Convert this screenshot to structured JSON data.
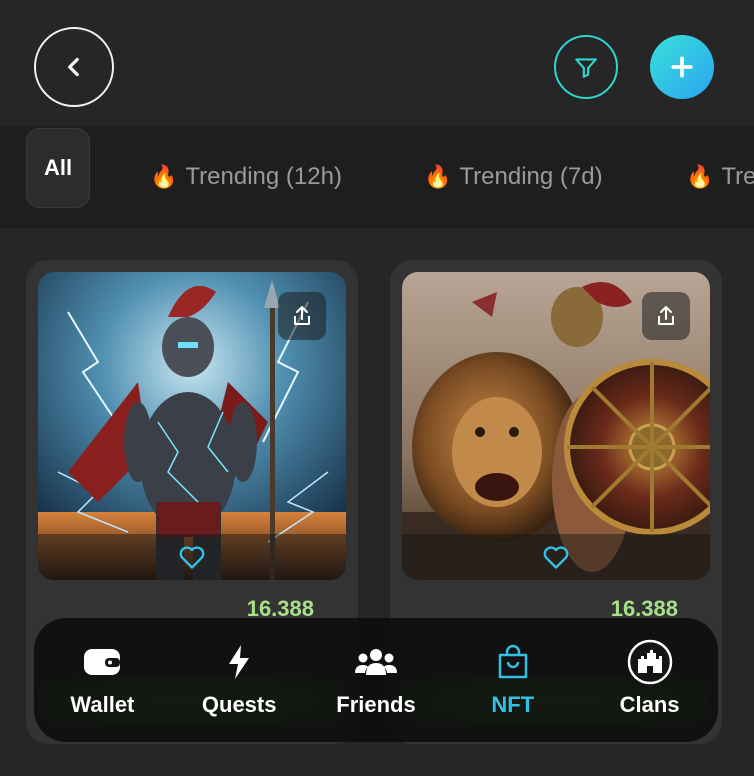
{
  "header": {
    "back_icon": "chevron-left-icon",
    "filter_icon": "filter-icon",
    "add_icon": "plus-icon",
    "accent": "#2fd6d0"
  },
  "tabs": [
    {
      "label": "All",
      "active": true
    },
    {
      "label": "Trending (12h)",
      "icon": "fire-icon"
    },
    {
      "label": "Trending (7d)",
      "icon": "fire-icon"
    },
    {
      "label": "Tre",
      "icon": "fire-icon"
    }
  ],
  "cards": [
    {
      "price": "16.388",
      "image": "spartan-lightning-warrior",
      "share_icon": "share-icon",
      "like_icon": "heart-icon"
    },
    {
      "price": "16.388",
      "image": "gladiator-with-lion",
      "share_icon": "share-icon",
      "like_icon": "heart-icon"
    }
  ],
  "nav": [
    {
      "label": "Wallet",
      "icon": "wallet-icon"
    },
    {
      "label": "Quests",
      "icon": "lightning-icon"
    },
    {
      "label": "Friends",
      "icon": "users-icon"
    },
    {
      "label": "NFT",
      "icon": "shopping-bag-icon",
      "active": true
    },
    {
      "label": "Clans",
      "icon": "castle-icon"
    }
  ],
  "colors": {
    "price": "#a8e088",
    "active_nav": "#33c0e6",
    "add_gradient_start": "#39e0d8",
    "add_gradient_end": "#2ba4f2"
  }
}
